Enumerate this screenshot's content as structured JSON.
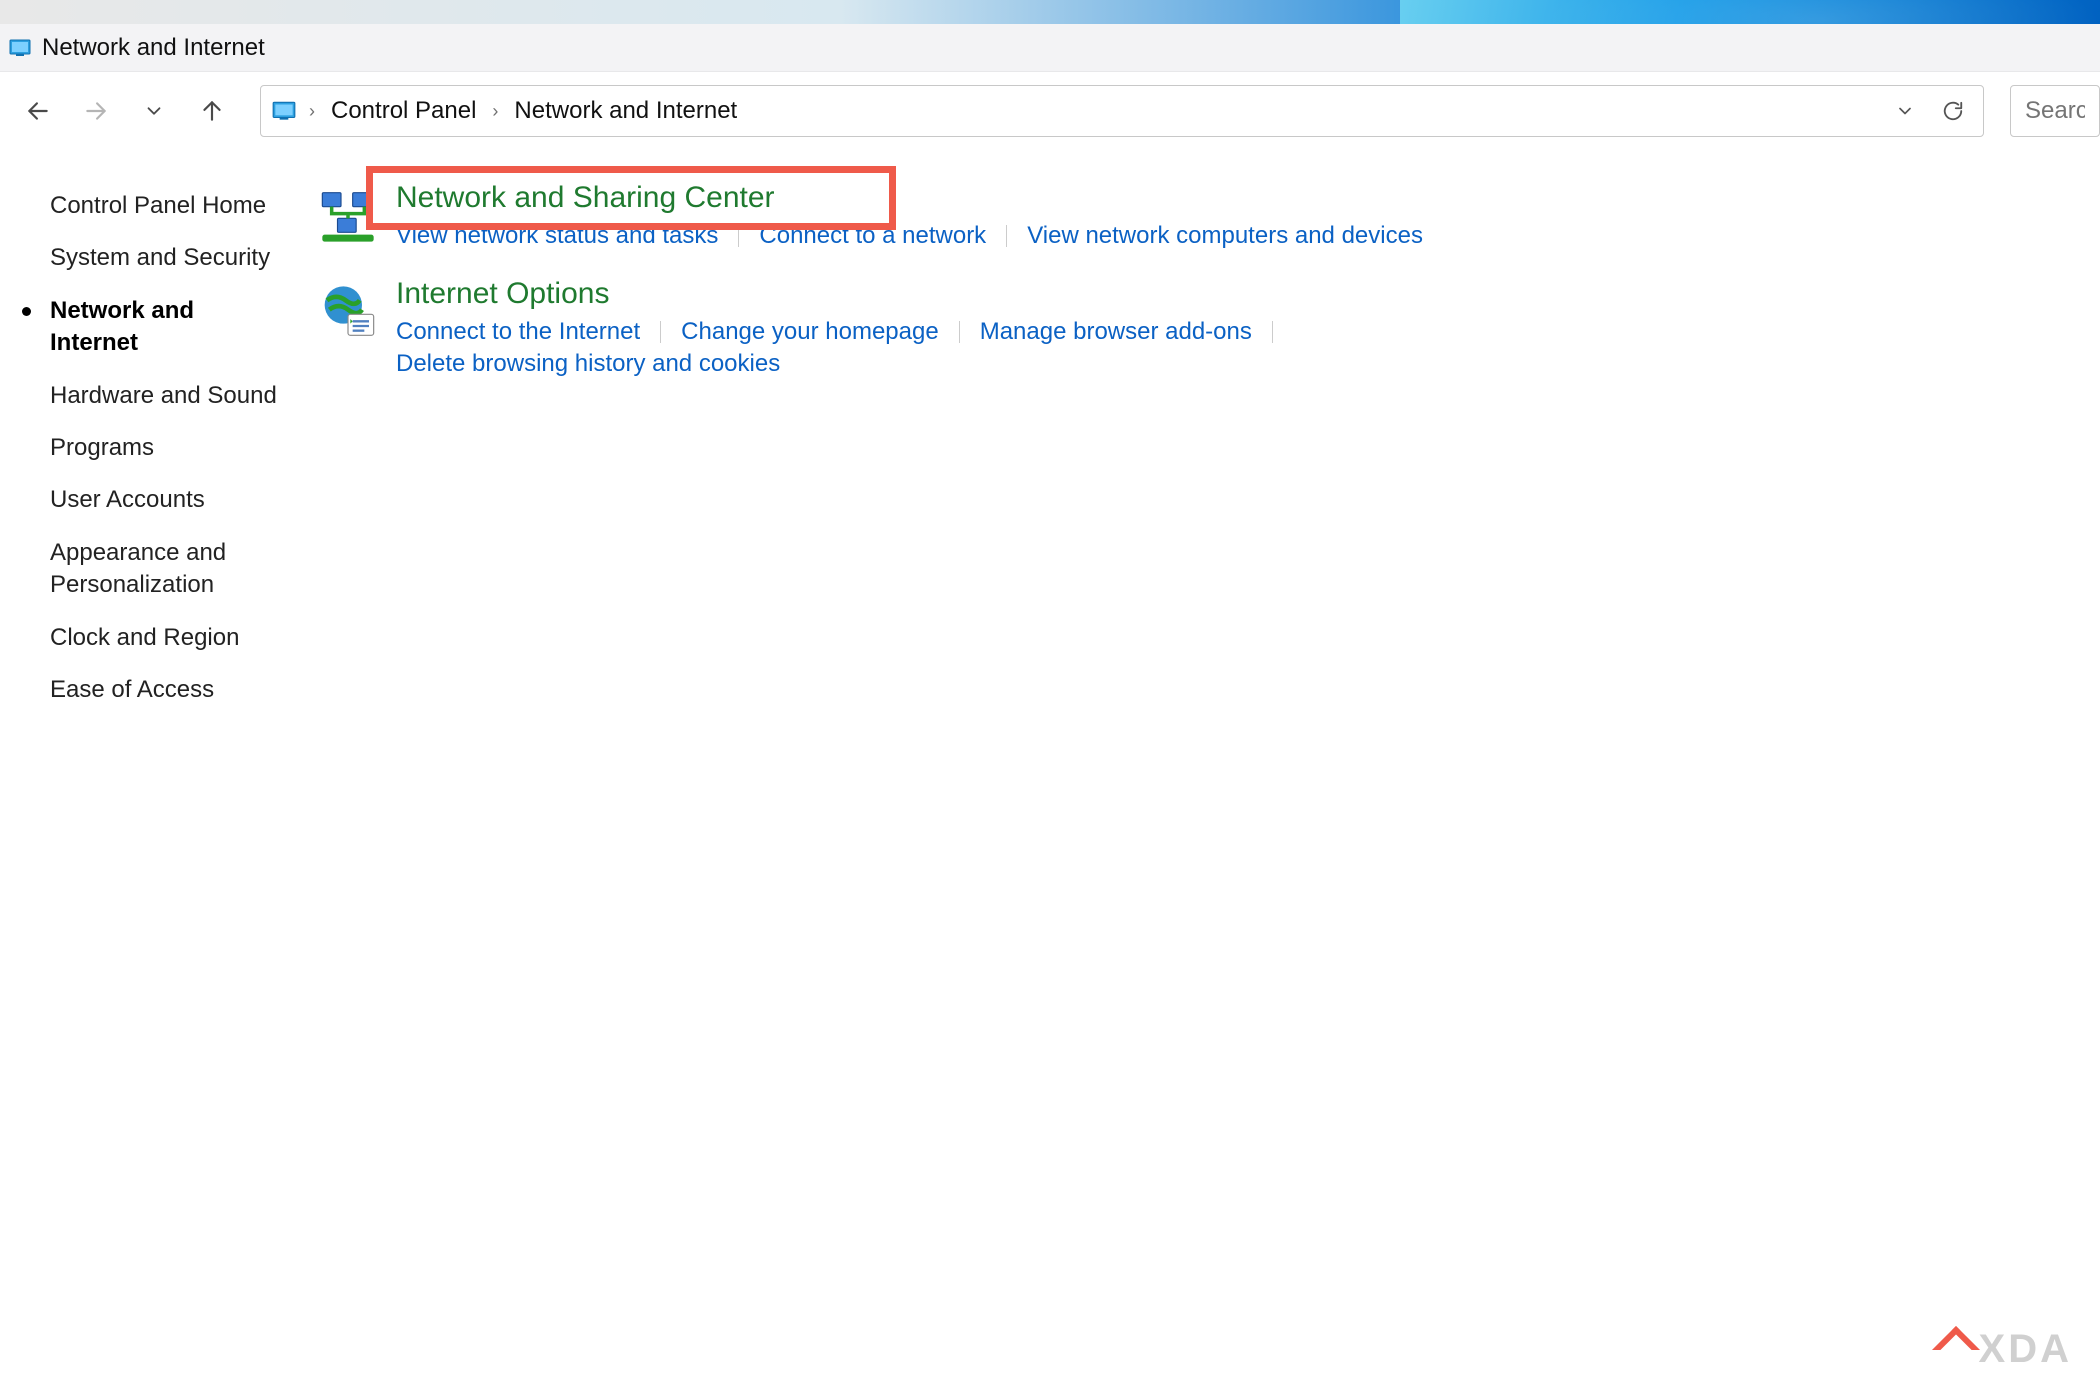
{
  "window": {
    "title": "Network and Internet"
  },
  "breadcrumbs": {
    "root": "Control Panel",
    "current": "Network and Internet"
  },
  "search": {
    "placeholder": "Search"
  },
  "sidebar": {
    "items": [
      {
        "label": "Control Panel Home",
        "active": false
      },
      {
        "label": "System and Security",
        "active": false
      },
      {
        "label": "Network and Internet",
        "active": true
      },
      {
        "label": "Hardware and Sound",
        "active": false
      },
      {
        "label": "Programs",
        "active": false
      },
      {
        "label": "User Accounts",
        "active": false
      },
      {
        "label": "Appearance and Personalization",
        "active": false
      },
      {
        "label": "Clock and Region",
        "active": false
      },
      {
        "label": "Ease of Access",
        "active": false
      }
    ]
  },
  "categories": [
    {
      "icon": "network-sharing-icon",
      "title": "Network and Sharing Center",
      "highlighted": true,
      "links": [
        "View network status and tasks",
        "Connect to a network",
        "View network computers and devices"
      ]
    },
    {
      "icon": "internet-options-icon",
      "title": "Internet Options",
      "highlighted": false,
      "links": [
        "Connect to the Internet",
        "Change your homepage",
        "Manage browser add-ons",
        "Delete browsing history and cookies"
      ]
    }
  ],
  "watermark": "XDA"
}
